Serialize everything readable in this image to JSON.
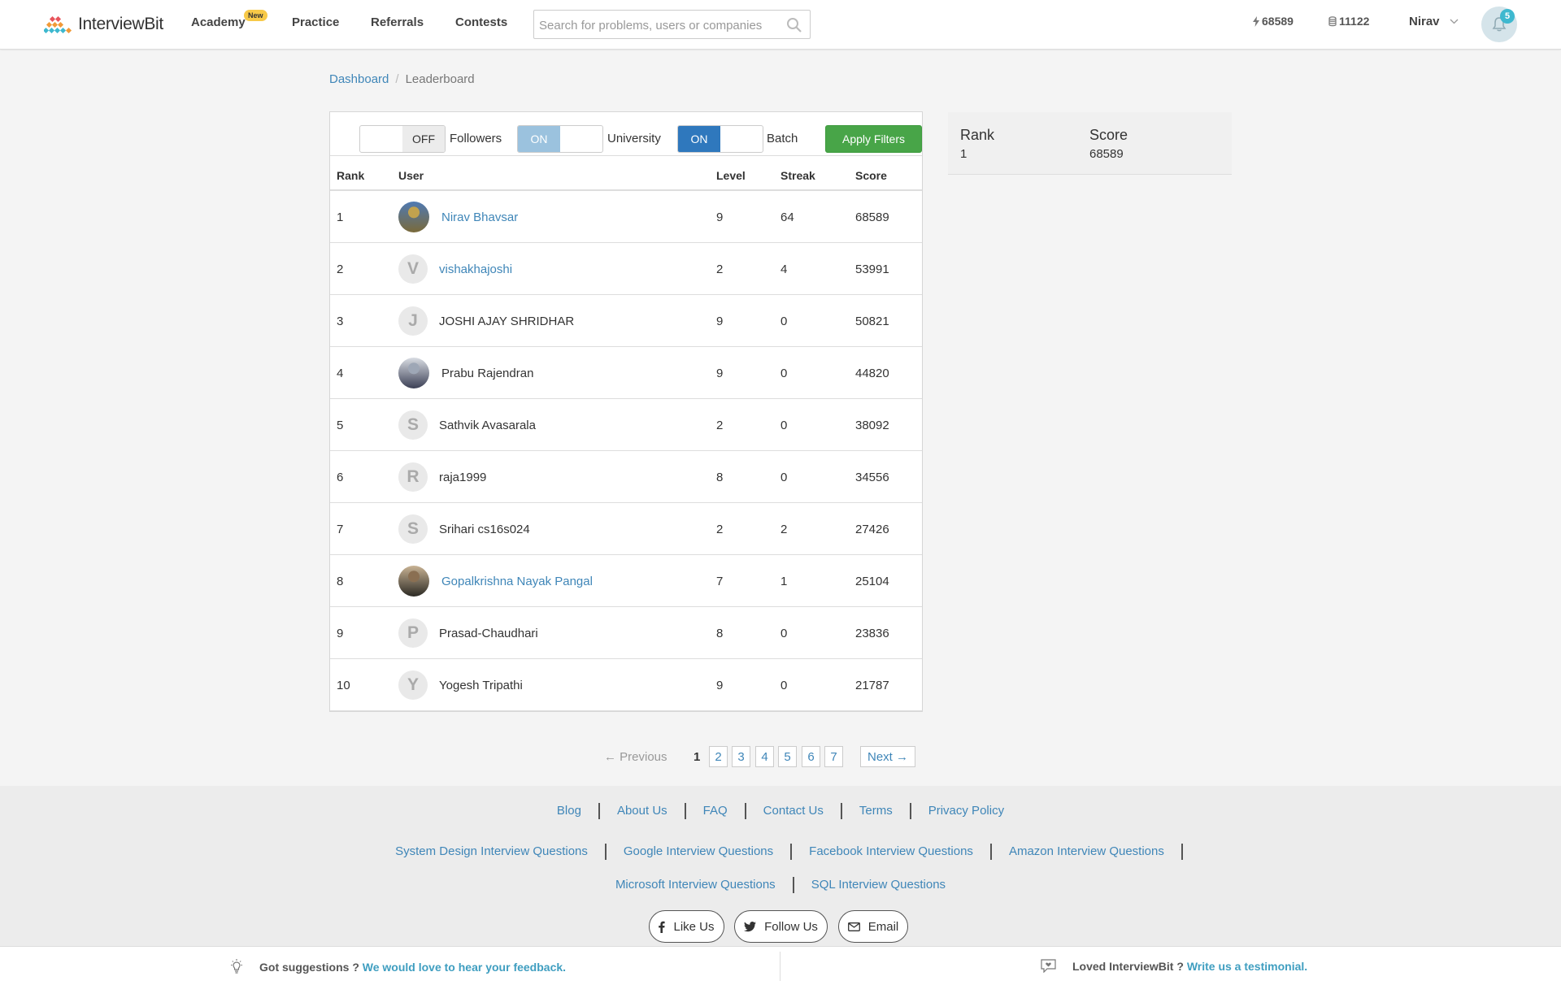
{
  "header": {
    "logo_text": "InterviewBit",
    "nav": [
      {
        "label": "Academy",
        "badge": "New"
      },
      {
        "label": "Practice"
      },
      {
        "label": "Referrals"
      },
      {
        "label": "Contests"
      }
    ],
    "search_placeholder": "Search for problems, users or companies",
    "score_stat": "68589",
    "coins_stat": "11122",
    "user_name": "Nirav",
    "notification_count": "5"
  },
  "breadcrumb": {
    "home": "Dashboard",
    "sep": "/",
    "current": "Leaderboard"
  },
  "filters": {
    "followers": {
      "state": "OFF",
      "label": "Followers"
    },
    "university": {
      "state": "ON",
      "label": "University"
    },
    "batch": {
      "state": "ON",
      "label": "Batch"
    },
    "apply_label": "Apply Filters"
  },
  "table": {
    "columns": [
      "Rank",
      "User",
      "Level",
      "Streak",
      "Score"
    ],
    "rows": [
      {
        "rank": "1",
        "user": "Nirav Bhavsar",
        "level": "9",
        "streak": "64",
        "score": "68589",
        "avatar": "photo",
        "link": true
      },
      {
        "rank": "2",
        "user": "vishakhajoshi",
        "level": "2",
        "streak": "4",
        "score": "53991",
        "avatar": "V",
        "link": true
      },
      {
        "rank": "3",
        "user": "JOSHI AJAY SHRIDHAR",
        "level": "9",
        "streak": "0",
        "score": "50821",
        "avatar": "J",
        "link": false
      },
      {
        "rank": "4",
        "user": "Prabu Rajendran",
        "level": "9",
        "streak": "0",
        "score": "44820",
        "avatar": "photo",
        "link": false
      },
      {
        "rank": "5",
        "user": "Sathvik Avasarala",
        "level": "2",
        "streak": "0",
        "score": "38092",
        "avatar": "S",
        "link": false
      },
      {
        "rank": "6",
        "user": "raja1999",
        "level": "8",
        "streak": "0",
        "score": "34556",
        "avatar": "R",
        "link": false
      },
      {
        "rank": "7",
        "user": "Srihari cs16s024",
        "level": "2",
        "streak": "2",
        "score": "27426",
        "avatar": "S",
        "link": false
      },
      {
        "rank": "8",
        "user": "Gopalkrishna Nayak Pangal",
        "level": "7",
        "streak": "1",
        "score": "25104",
        "avatar": "photo",
        "link": true
      },
      {
        "rank": "9",
        "user": "Prasad-Chaudhari",
        "level": "8",
        "streak": "0",
        "score": "23836",
        "avatar": "P",
        "link": false
      },
      {
        "rank": "10",
        "user": "Yogesh Tripathi",
        "level": "9",
        "streak": "0",
        "score": "21787",
        "avatar": "Y",
        "link": false
      }
    ]
  },
  "summary": {
    "rank_label": "Rank",
    "rank_value": "1",
    "score_label": "Score",
    "score_value": "68589"
  },
  "pagination": {
    "prev": "← Previous",
    "current": "1",
    "pages": [
      "2",
      "3",
      "4",
      "5",
      "6",
      "7"
    ],
    "next": "Next →"
  },
  "footer": {
    "row1": [
      "Blog",
      "About Us",
      "FAQ",
      "Contact Us",
      "Terms",
      "Privacy Policy"
    ],
    "row2": [
      "System Design Interview Questions",
      "Google Interview Questions",
      "Facebook Interview Questions",
      "Amazon Interview Questions"
    ],
    "row3": [
      "Microsoft Interview Questions",
      "SQL Interview Questions"
    ],
    "social": [
      "Like Us",
      "Follow Us",
      "Email"
    ]
  },
  "feedback": {
    "suggest_text": "Got suggestions ?",
    "suggest_link": "We would love to hear your feedback.",
    "loved_text": "Loved InterviewBit ?",
    "loved_link": "Write us a testimonial."
  },
  "colors": {
    "accent": "#3f86b8",
    "apply_green": "#48a548",
    "toggle_on_dark": "#2f78bd",
    "toggle_on_light": "#9bc2de"
  }
}
